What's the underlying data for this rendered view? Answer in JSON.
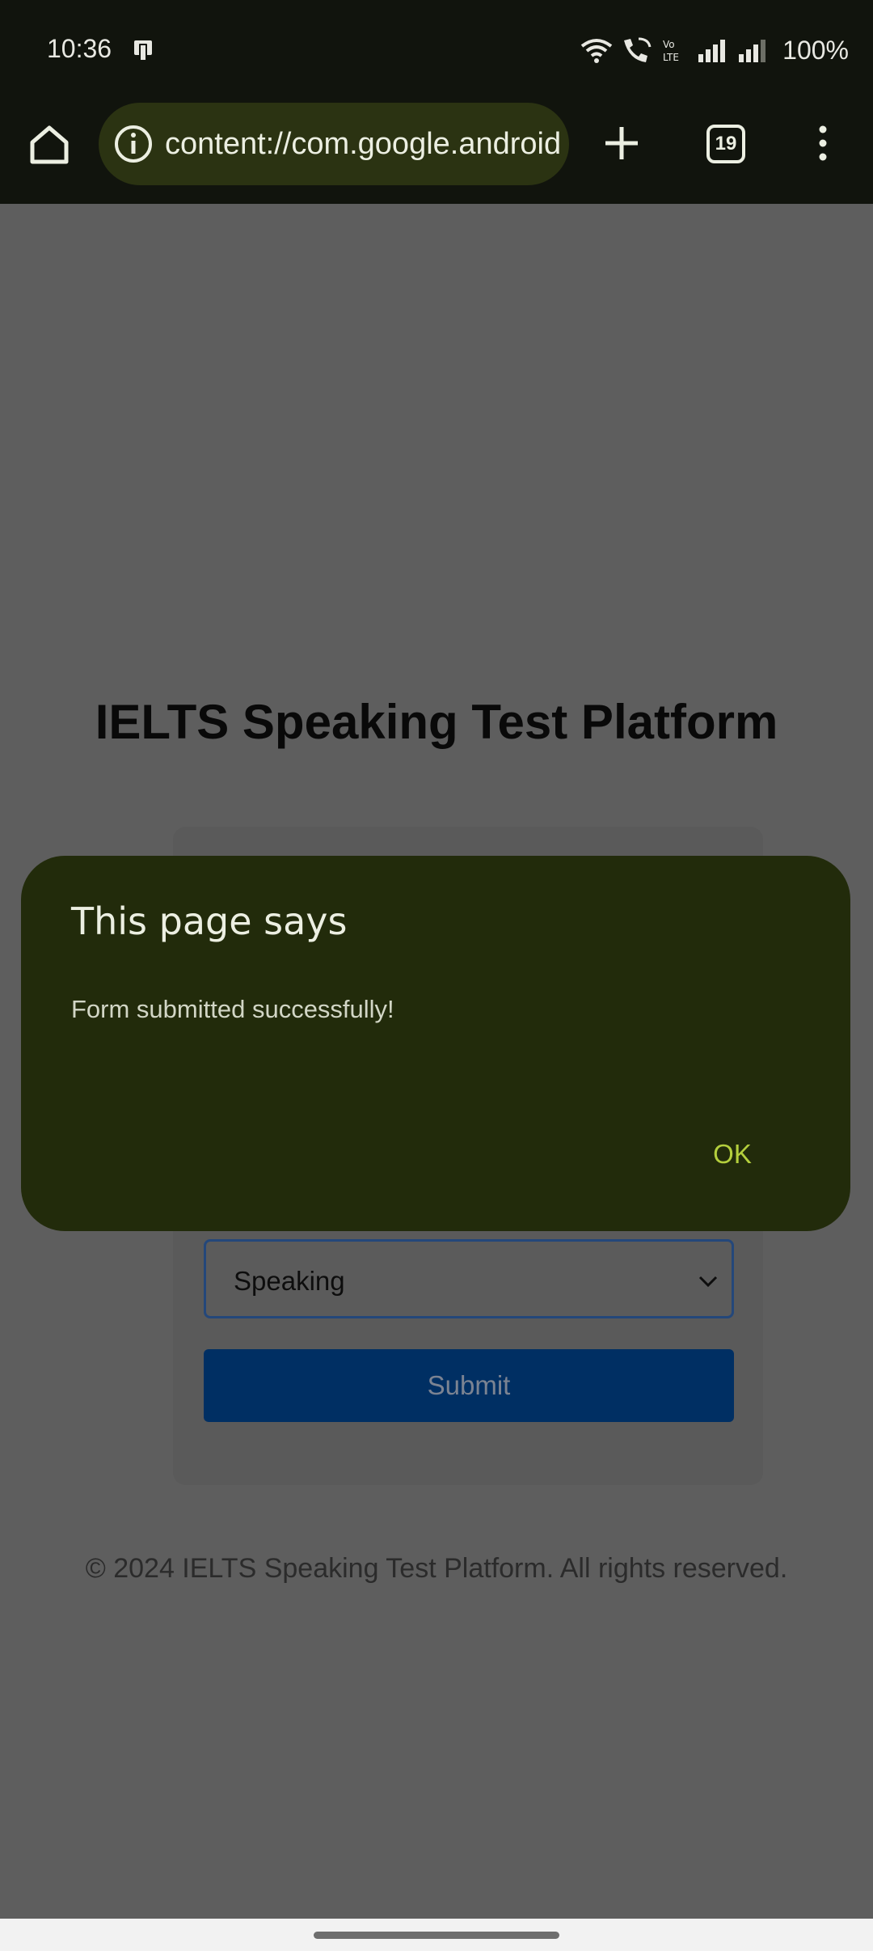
{
  "status_bar": {
    "time": "10:36",
    "battery": "100%",
    "icons": [
      "sim-card-icon",
      "wifi-icon",
      "wifi-calling-icon",
      "volte-icon",
      "signal-icon",
      "signal-icon"
    ]
  },
  "browser": {
    "url": "content://com.google.android",
    "tab_count": "19",
    "icons": [
      "home-icon",
      "site-info-icon",
      "new-tab-icon",
      "more-menu-icon"
    ]
  },
  "page": {
    "title": "IELTS Speaking Test Platform",
    "select_value": "Speaking",
    "submit_label": "Submit",
    "footer": "© 2024 IELTS Speaking Test Platform. All rights reserved."
  },
  "dialog": {
    "title": "This page says",
    "message": "Form submitted successfully!",
    "ok_label": "OK"
  },
  "colors": {
    "toolbar_bg": "#11140d",
    "omnibox_bg": "#2b3312",
    "dialog_bg": "#222b0b",
    "dialog_accent": "#b4cf3d",
    "submit_bg": "#002f63"
  }
}
